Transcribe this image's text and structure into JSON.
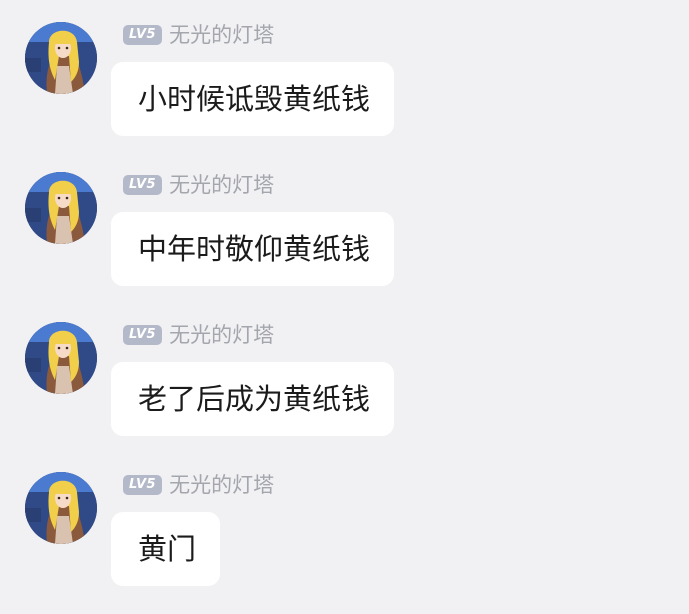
{
  "messages": [
    {
      "level": "LV5",
      "username": "无光的灯塔",
      "text": "小时候诋毁黄纸钱",
      "avatar_icon": "anime-avatar-icon"
    },
    {
      "level": "LV5",
      "username": "无光的灯塔",
      "text": "中年时敬仰黄纸钱",
      "avatar_icon": "anime-avatar-icon"
    },
    {
      "level": "LV5",
      "username": "无光的灯塔",
      "text": "老了后成为黄纸钱",
      "avatar_icon": "anime-avatar-icon"
    },
    {
      "level": "LV5",
      "username": "无光的灯塔",
      "text": "黄门",
      "avatar_icon": "anime-avatar-icon"
    }
  ],
  "colors": {
    "background": "#f1f1f3",
    "bubble": "#ffffff",
    "level_badge": "#b4b9c9",
    "username": "#a4a6ad",
    "message_text": "#1b1b1b"
  }
}
